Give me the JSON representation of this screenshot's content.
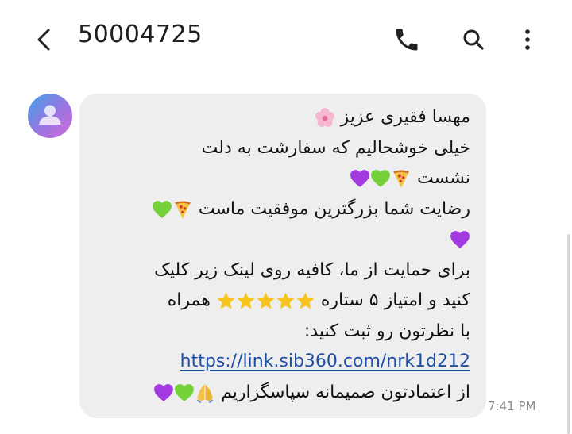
{
  "header": {
    "title": "50004725",
    "back_icon": "back-arrow-icon",
    "call_icon": "phone-icon",
    "search_icon": "search-icon",
    "menu_icon": "more-vertical-icon"
  },
  "avatar": {
    "icon": "person-icon",
    "gradient": [
      "#3fa3e8",
      "#9a74e0",
      "#d36bd8"
    ]
  },
  "message": {
    "lines": [
      "مهسا فقیری عزیز",
      "خیلی خوشحالیم که سفارشت به دلت",
      "نشست",
      "رضایت شما بزرگترین موفقیت ماست",
      "",
      "برای حمایت از ما، کافیه روی لینک زیر کلیک",
      "کنید و امتیاز ۵ ستاره",
      "با نظرتون رو ثبت کنید:",
      "",
      "از اعتمادتون صمیمانه سپاسگزاریم"
    ],
    "line7_tail": "همراه",
    "link": "https://link.sib360.com/nrk1d212",
    "emojis": {
      "line1": "cherry-blossom",
      "line3": [
        "pizza",
        "green-heart",
        "purple-heart"
      ],
      "line4": [
        "pizza",
        "green-heart"
      ],
      "line5": [
        "purple-heart"
      ],
      "line7": [
        "star",
        "star",
        "star",
        "star",
        "star"
      ],
      "line10": [
        "folded-hands",
        "green-heart",
        "purple-heart"
      ]
    },
    "timestamp": "7:41 PM"
  },
  "colors": {
    "bubble": "#eeeeee",
    "link": "#1e4fa8",
    "text": "#111111",
    "timestamp": "#8a8a8a"
  }
}
